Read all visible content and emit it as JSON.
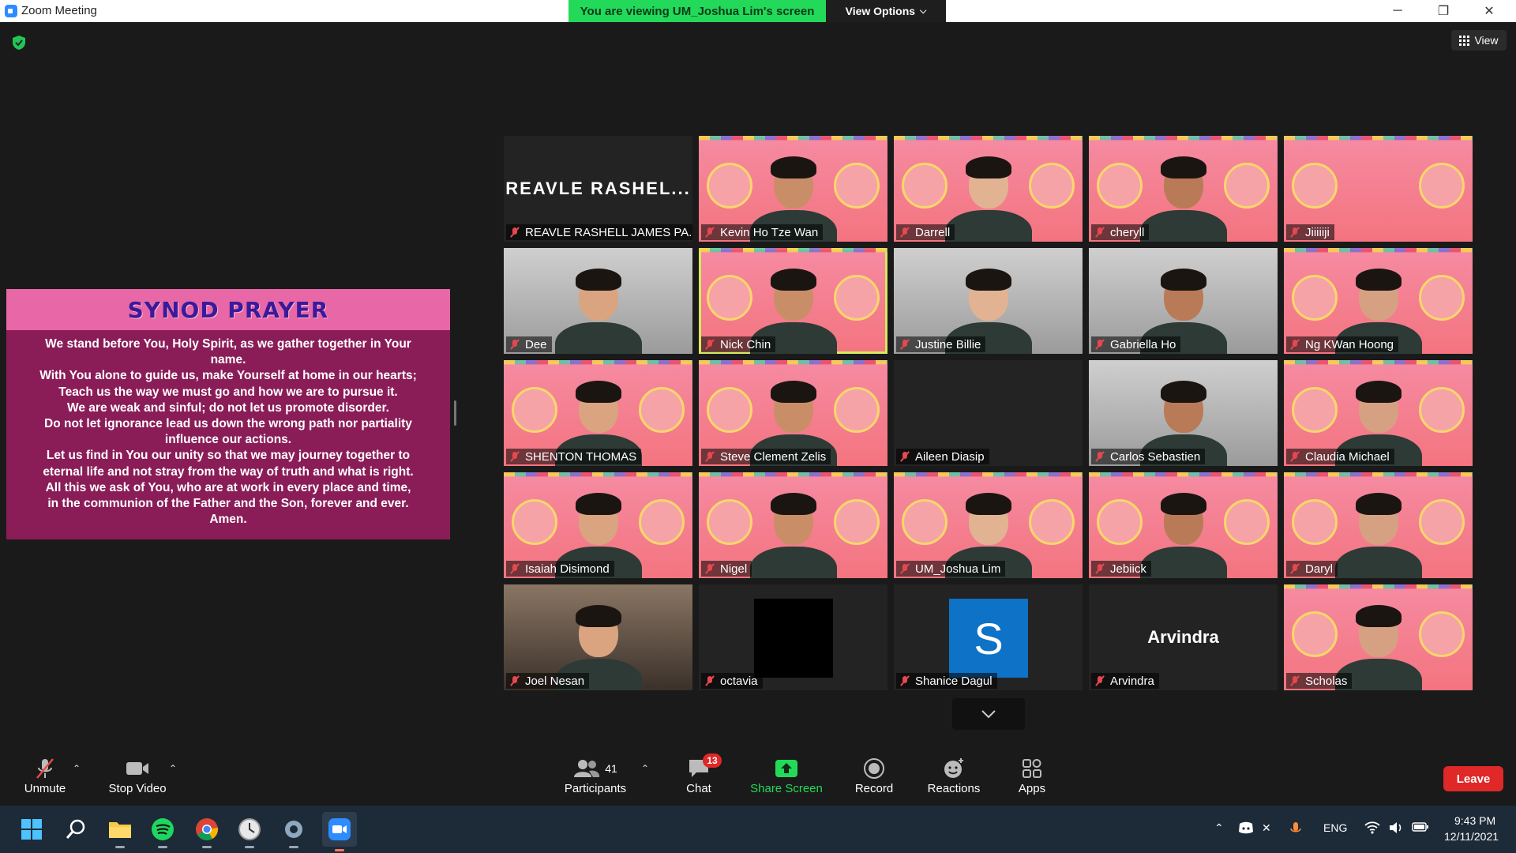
{
  "window": {
    "title": "Zoom Meeting",
    "viewing_banner": "You are viewing UM_Joshua Lim's screen",
    "view_options": "View Options",
    "view_button": "View"
  },
  "shared_screen": {
    "heading": "SYNOD PRAYER",
    "lines": [
      "We stand before You, Holy Spirit, as we gather together in Your",
      "name.",
      "With You alone to guide us, make Yourself at home in our hearts;",
      "Teach us the way we must go and how we are to pursue it.",
      "We are weak and sinful; do not let us promote disorder.",
      "Do not let ignorance lead us down the wrong path nor partiality",
      "influence our actions.",
      "Let us find in You our unity so that we may journey together to",
      "eternal life and not stray from the way of truth and what is right.",
      "All this we ask of You, who are at work in every place and time,",
      "in the communion of the Father and the Son, forever and ever.",
      "Amen."
    ]
  },
  "participants_grid": [
    {
      "name": "REAVLE RASHELL JAMES PA...",
      "display": "REAVLE RASHEL...",
      "kind": "name-only"
    },
    {
      "name": "Kevin Ho Tze Wan",
      "kind": "video-pink"
    },
    {
      "name": "Darrell",
      "kind": "video-pink"
    },
    {
      "name": "cheryll",
      "kind": "video-pink"
    },
    {
      "name": "Jiiiiiji",
      "kind": "video-pink-empty"
    },
    {
      "name": "Dee",
      "kind": "video-room"
    },
    {
      "name": "Nick Chin",
      "kind": "video-pink",
      "active": true
    },
    {
      "name": "Justine Billie",
      "kind": "video-room"
    },
    {
      "name": "Gabriella Ho",
      "kind": "video-room"
    },
    {
      "name": "Ng KWan Hoong",
      "kind": "video-pink"
    },
    {
      "name": "SHENTON THOMAS",
      "kind": "video-pink"
    },
    {
      "name": "Steve Clement Zelis",
      "kind": "video-pink"
    },
    {
      "name": "Aileen Diasip",
      "kind": "dark"
    },
    {
      "name": "Carlos Sebastien",
      "kind": "video-room"
    },
    {
      "name": "Claudia Michael",
      "kind": "video-pink"
    },
    {
      "name": "Isaiah Disimond",
      "kind": "video-pink"
    },
    {
      "name": "Nigel",
      "kind": "video-pink"
    },
    {
      "name": "UM_Joshua Lim",
      "kind": "video-pink"
    },
    {
      "name": "Jebiick",
      "kind": "video-pink"
    },
    {
      "name": "Daryl",
      "kind": "video-pink"
    },
    {
      "name": "Joel Nesan",
      "kind": "video-room2"
    },
    {
      "name": "octavia",
      "kind": "avatar-black"
    },
    {
      "name": "Shanice Dagul",
      "kind": "avatar-s",
      "initial": "S"
    },
    {
      "name": "Arvindra",
      "display": "Arvindra",
      "kind": "name-only"
    },
    {
      "name": "Scholas",
      "kind": "video-pink"
    }
  ],
  "toolbar": {
    "unmute": "Unmute",
    "stop_video": "Stop Video",
    "participants": "Participants",
    "participants_count": "41",
    "chat": "Chat",
    "chat_badge": "13",
    "share_screen": "Share Screen",
    "record": "Record",
    "reactions": "Reactions",
    "apps": "Apps",
    "leave": "Leave"
  },
  "taskbar": {
    "language": "ENG",
    "time": "9:43 PM",
    "date": "12/11/2021"
  },
  "colors": {
    "share_green": "#23d959",
    "leave_red": "#e02828",
    "prayer_bg": "#8a1d58",
    "prayer_header": "#e867a6"
  }
}
